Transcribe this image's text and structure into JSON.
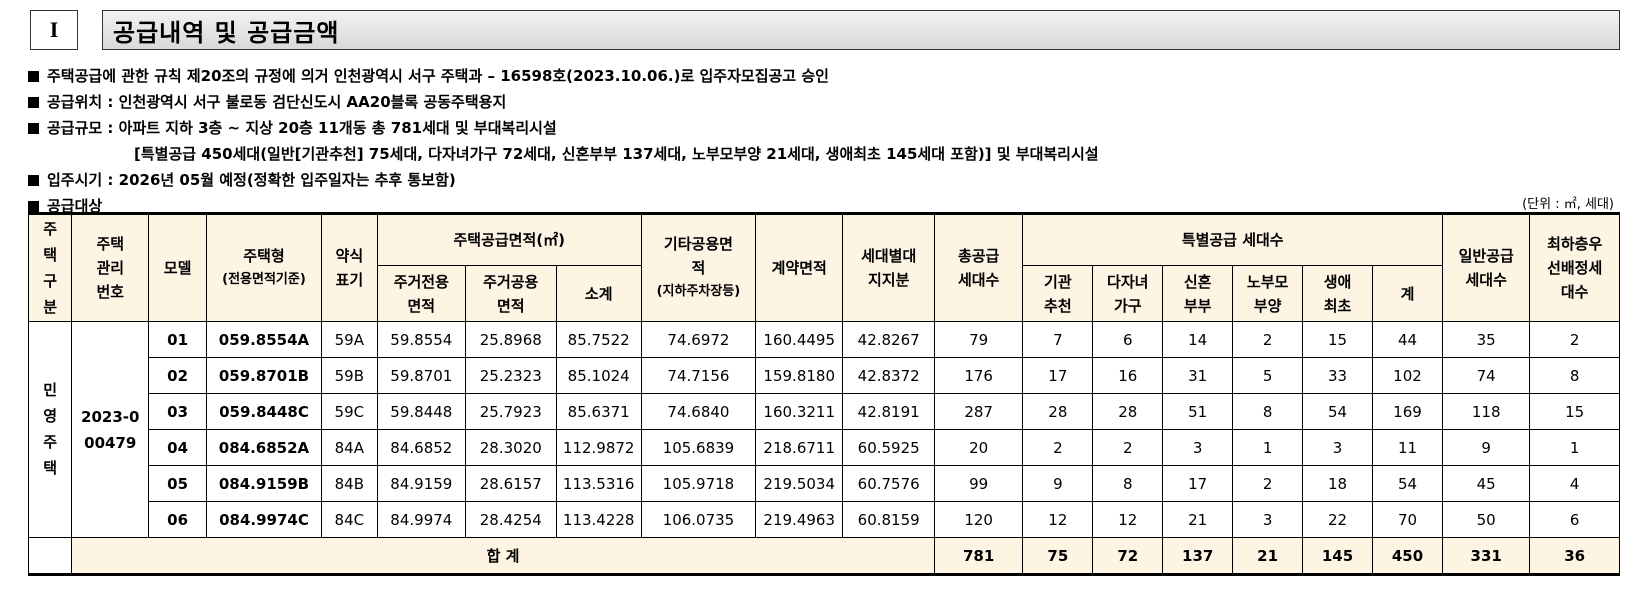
{
  "section": {
    "number": "I",
    "title": "공급내역 및 공급금액"
  },
  "bullets": [
    "주택공급에 관한 규칙 제20조의 규정에 의거 인천광역시 서구 주택과 – 16598호(2023.10.06.)로 입주자모집공고 승인",
    "공급위치 : 인천광역시 서구 불로동 검단신도시 AA20블록 공동주택용지",
    "공급규모 : 아파트 지하 3층 ~ 지상 20층 11개동 총 781세대 및 부대복리시설",
    "[특별공급 450세대(일반[기관추천] 75세대, 다자녀가구 72세대, 신혼부부 137세대, 노부모부양 21세대, 생애최초 145세대 포함)] 및 부대복리시설",
    "입주시기 : 2026년 05월 예정(정확한 입주일자는 추후 통보함)",
    "공급대상"
  ],
  "unit_note": "(단위 : ㎡, 세대)",
  "headers": {
    "type": "주택구분",
    "mgmt_no": "주택관리번호",
    "model": "모델",
    "housing_type": "주택형",
    "housing_type_sub": "(전용면적기준)",
    "abbr": "약식표기",
    "supply_area": "주택공급면적(㎡)",
    "exclusive": "주거전용면적",
    "common": "주거공용면적",
    "subtotal": "소계",
    "other_common": "기타공용면적",
    "other_common_sub": "(지하주차장등)",
    "contract_area": "계약면적",
    "land_share": "세대별대지지분",
    "total_supply": "총공급세대수",
    "special": "특별공급 세대수",
    "institution": "기관추천",
    "multichild": "다자녀가구",
    "newlywed": "신혼부부",
    "elderly": "노부모부양",
    "firsttime": "생애최초",
    "sum": "계",
    "general": "일반공급세대수",
    "lowest": "최하층우선배정세대수"
  },
  "group": {
    "type": "민영주택",
    "mgmt_no": "2023-000479"
  },
  "rows": [
    {
      "model": "01",
      "type": "059.8554A",
      "abbr": "59A",
      "excl": "59.8554",
      "common": "25.8968",
      "sub": "85.7522",
      "other": "74.6972",
      "contract": "160.4495",
      "land": "42.8267",
      "total": "79",
      "inst": "7",
      "multi": "6",
      "newly": "14",
      "elder": "2",
      "first": "15",
      "sum": "44",
      "general": "35",
      "lowest": "2"
    },
    {
      "model": "02",
      "type": "059.8701B",
      "abbr": "59B",
      "excl": "59.8701",
      "common": "25.2323",
      "sub": "85.1024",
      "other": "74.7156",
      "contract": "159.8180",
      "land": "42.8372",
      "total": "176",
      "inst": "17",
      "multi": "16",
      "newly": "31",
      "elder": "5",
      "first": "33",
      "sum": "102",
      "general": "74",
      "lowest": "8"
    },
    {
      "model": "03",
      "type": "059.8448C",
      "abbr": "59C",
      "excl": "59.8448",
      "common": "25.7923",
      "sub": "85.6371",
      "other": "74.6840",
      "contract": "160.3211",
      "land": "42.8191",
      "total": "287",
      "inst": "28",
      "multi": "28",
      "newly": "51",
      "elder": "8",
      "first": "54",
      "sum": "169",
      "general": "118",
      "lowest": "15"
    },
    {
      "model": "04",
      "type": "084.6852A",
      "abbr": "84A",
      "excl": "84.6852",
      "common": "28.3020",
      "sub": "112.9872",
      "other": "105.6839",
      "contract": "218.6711",
      "land": "60.5925",
      "total": "20",
      "inst": "2",
      "multi": "2",
      "newly": "3",
      "elder": "1",
      "first": "3",
      "sum": "11",
      "general": "9",
      "lowest": "1"
    },
    {
      "model": "05",
      "type": "084.9159B",
      "abbr": "84B",
      "excl": "84.9159",
      "common": "28.6157",
      "sub": "113.5316",
      "other": "105.9718",
      "contract": "219.5034",
      "land": "60.7576",
      "total": "99",
      "inst": "9",
      "multi": "8",
      "newly": "17",
      "elder": "2",
      "first": "18",
      "sum": "54",
      "general": "45",
      "lowest": "4"
    },
    {
      "model": "06",
      "type": "084.9974C",
      "abbr": "84C",
      "excl": "84.9974",
      "common": "28.4254",
      "sub": "113.4228",
      "other": "106.0735",
      "contract": "219.4963",
      "land": "60.8159",
      "total": "120",
      "inst": "12",
      "multi": "12",
      "newly": "21",
      "elder": "3",
      "first": "22",
      "sum": "70",
      "general": "50",
      "lowest": "6"
    }
  ],
  "total": {
    "label": "합 계",
    "total": "781",
    "inst": "75",
    "multi": "72",
    "newly": "137",
    "elder": "21",
    "first": "145",
    "sum": "450",
    "general": "331",
    "lowest": "36"
  }
}
